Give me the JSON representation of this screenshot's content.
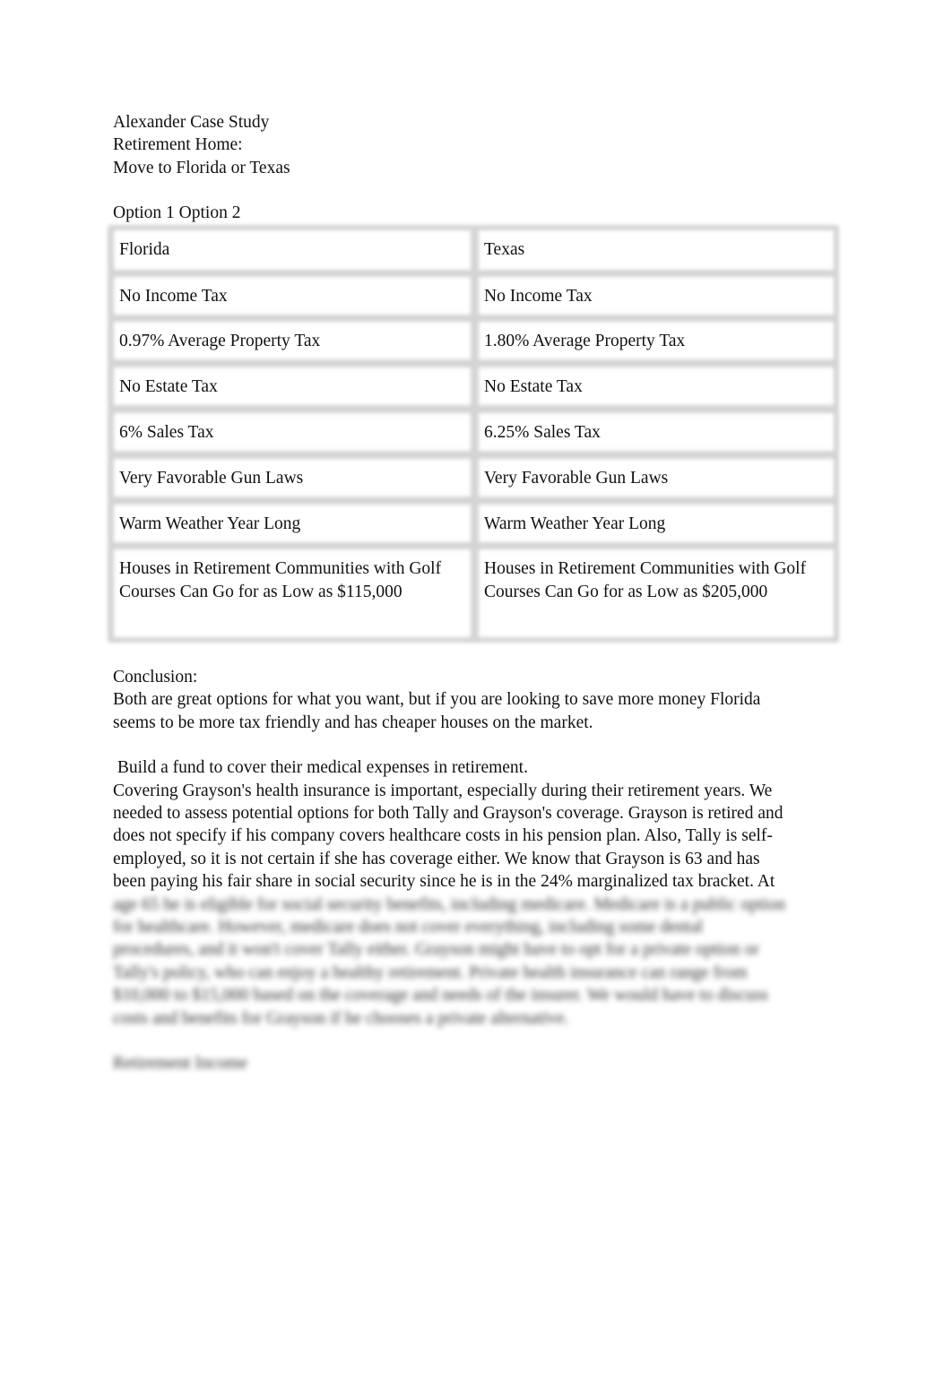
{
  "header": {
    "title": "Alexander Case Study",
    "subtitle": "Retirement Home:",
    "question": "Move to Florida or Texas",
    "options_label": "Option 1 Option 2"
  },
  "comparison_table": {
    "headers": [
      "Florida",
      "Texas"
    ],
    "rows": [
      [
        "No Income Tax",
        "No Income Tax"
      ],
      [
        "0.97% Average Property Tax",
        "1.80% Average Property Tax"
      ],
      [
        "No Estate Tax",
        "No Estate Tax"
      ],
      [
        "6% Sales Tax",
        "6.25% Sales Tax"
      ],
      [
        "Very Favorable Gun Laws",
        "Very Favorable Gun Laws"
      ],
      [
        "Warm Weather Year Long",
        "Warm Weather Year Long"
      ],
      [
        "Houses in Retirement Communities with Golf Courses Can Go for as Low as $115,000",
        "Houses in Retirement Communities with Golf Courses Can Go for as Low as $205,000"
      ]
    ]
  },
  "conclusion": {
    "heading": "Conclusion:",
    "lines": [
      "Both are great options for what you want, but if you are looking to save more money Florida",
      "seems to be more tax friendly and has cheaper houses on the market."
    ]
  },
  "medical": {
    "heading": " Build a fund to cover their medical expenses in retirement.",
    "lines": [
      "Covering Grayson's health insurance is important, especially during their retirement years. We",
      "needed to assess potential options for both Tally and Grayson's coverage. Grayson is retired and",
      "does not specify if his company covers healthcare costs in his pension plan. Also, Tally is self-",
      "employed, so it is not certain if she has coverage either. We know that Grayson is 63 and has",
      "been paying his fair share in social security since he is in the 24% marginalized tax bracket. At"
    ],
    "blurred_lines": [
      "age 65 he is eligible for social security benefits, including medicare. Medicare is a public option",
      "for healthcare. However, medicare does not cover everything, including some dental",
      "procedures, and it won't cover Tally either. Grayson might have to opt for a private option or",
      "Tally's policy, who can enjoy a healthy retirement. Private health insurance can range from",
      "$10,000 to $15,000 based on the coverage and needs of the insurer. We would have to discuss",
      "costs and benefits for Grayson if he chooses a private alternative."
    ]
  },
  "next_section": {
    "heading": "Retirement Income"
  }
}
